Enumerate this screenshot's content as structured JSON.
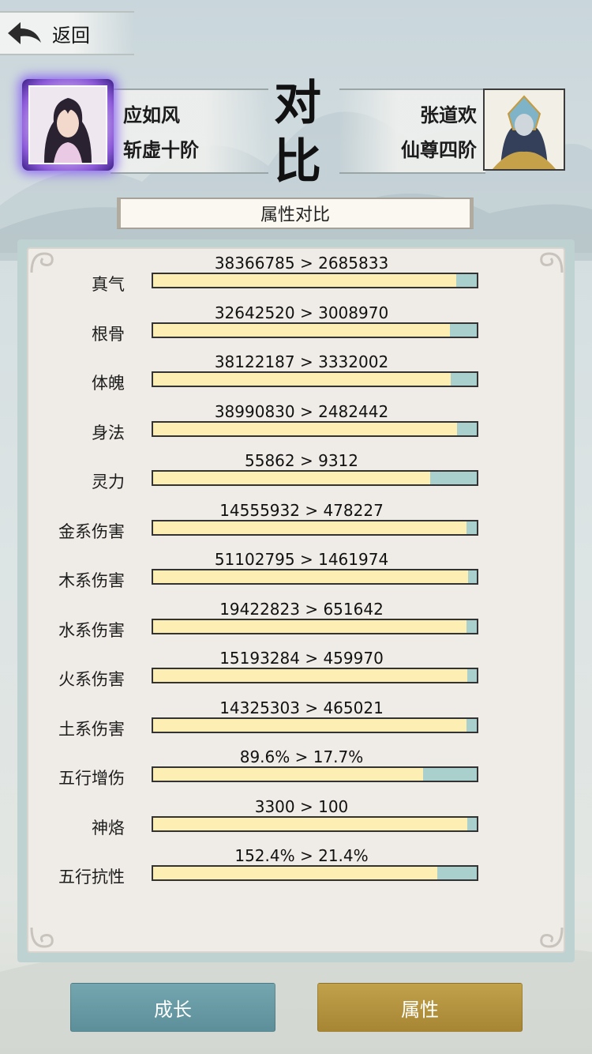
{
  "header": {
    "back_label": "返回"
  },
  "players": {
    "left": {
      "name": "应如风",
      "realm": "斩虚十阶"
    },
    "right": {
      "name": "张道欢",
      "realm": "仙尊四阶"
    }
  },
  "title": {
    "char1": "对",
    "char2": "比"
  },
  "section_title": "属性对比",
  "stats": [
    {
      "label": "真气",
      "value": "38366785 > 2685833",
      "fill": 0.937
    },
    {
      "label": "根骨",
      "value": "32642520 > 3008970",
      "fill": 0.916
    },
    {
      "label": "体魄",
      "value": "38122187 > 3332002",
      "fill": 0.92
    },
    {
      "label": "身法",
      "value": "38990830 > 2482442",
      "fill": 0.94
    },
    {
      "label": "灵力",
      "value": "55862 > 9312",
      "fill": 0.857
    },
    {
      "label": "金系伤害",
      "value": "14555932 > 478227",
      "fill": 0.968
    },
    {
      "label": "木系伤害",
      "value": "51102795 > 1461974",
      "fill": 0.972
    },
    {
      "label": "水系伤害",
      "value": "19422823 > 651642",
      "fill": 0.968
    },
    {
      "label": "火系伤害",
      "value": "15193284 > 459970",
      "fill": 0.97
    },
    {
      "label": "土系伤害",
      "value": "14325303 > 465021",
      "fill": 0.968
    },
    {
      "label": "五行增伤",
      "value": "89.6% > 17.7%",
      "fill": 0.835
    },
    {
      "label": "神烙",
      "value": "3300 > 100",
      "fill": 0.97
    },
    {
      "label": "五行抗性",
      "value": "152.4% > 21.4%",
      "fill": 0.877
    }
  ],
  "buttons": {
    "growth": "成长",
    "attributes": "属性"
  },
  "colors": {
    "bar_fill": "#fdefb4",
    "bar_bg": "#a9d0cd",
    "growth_btn": "#6b9ea8",
    "attr_btn": "#b5953f"
  },
  "icons": {
    "back": "back-arrow-icon"
  }
}
